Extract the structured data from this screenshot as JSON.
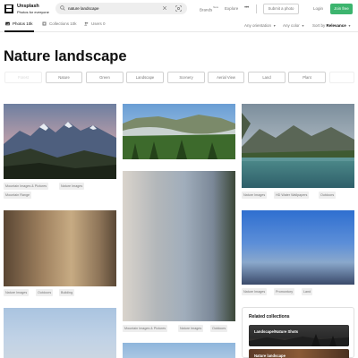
{
  "brand": {
    "name": "Unsplash",
    "tagline": "Photos for everyone"
  },
  "search": {
    "query": "nature landscape"
  },
  "nav": {
    "brands": "Brands",
    "brands_badge": "New",
    "explore": "Explore",
    "more": "•••",
    "submit": "Submit a photo",
    "login": "Login",
    "join": "Join free"
  },
  "tabs": [
    {
      "label": "Photos 10k",
      "active": true
    },
    {
      "label": "Collections 10k",
      "active": false
    },
    {
      "label": "Users 0",
      "active": false
    }
  ],
  "filters": {
    "orientation": "Any orientation",
    "color": "Any color",
    "sort_prefix": "Sort by",
    "sort_value": "Relevance"
  },
  "page_title": "Nature landscape",
  "chips": [
    "Forest",
    "Nature",
    "Green",
    "Landscape",
    "Scenery",
    "Aerial View",
    "Land",
    "Plant"
  ],
  "columns": {
    "col1": {
      "photo1_tags": [
        "Mountain Images & Pictures",
        "Nature Images",
        "Mountain Range"
      ],
      "photo2_tags": [
        "Nature Images",
        "Outdoors",
        "Building"
      ]
    },
    "col2": {
      "photo2_tags": [
        "Mountain Images & Pictures",
        "Nature Images",
        "Outdoors"
      ]
    },
    "col3": {
      "photo1_tags": [
        "Nature Images",
        "HD Water Wallpapers",
        "Outdoors"
      ],
      "photo2_tags": [
        "Nature Images",
        "Promontory",
        "Land"
      ]
    }
  },
  "related": {
    "title": "Related collections",
    "items": [
      "Landscape/Nature Shots",
      "Nature landscape"
    ]
  },
  "colors": {
    "accent_green": "#3cb46e",
    "text_primary": "#111111",
    "text_secondary": "#767676",
    "border": "#d1d1d1"
  }
}
